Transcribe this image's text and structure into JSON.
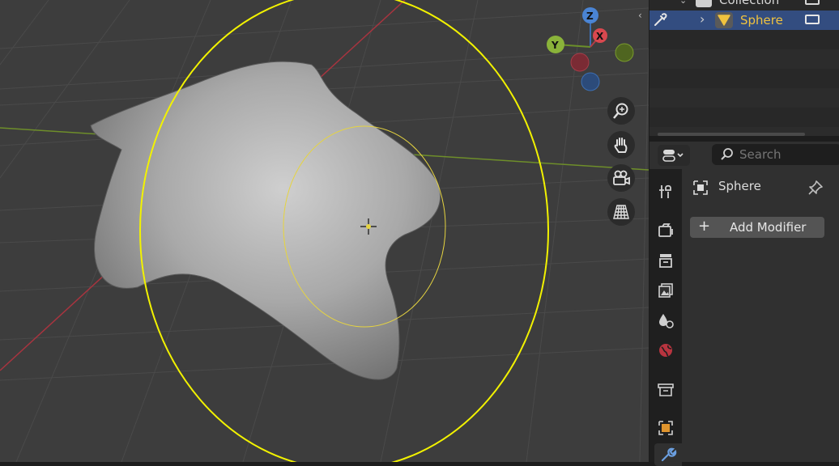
{
  "viewport": {
    "gizmo": {
      "z_label": "Z",
      "x_label": "X",
      "y_label": "Y"
    },
    "nav_buttons": [
      "zoom-icon",
      "pan-hand-icon",
      "camera-icon",
      "ortho-grid-icon"
    ],
    "colors": {
      "background": "#3d3d3d",
      "selection": "#f2f200",
      "x_axis": "#a8343f",
      "y_axis": "#7da02b"
    }
  },
  "outliner": {
    "collection_label": "Collection",
    "object_label": "Sphere",
    "colors": {
      "selected_row": "#334d80",
      "active_text": "#f0c23e"
    }
  },
  "properties": {
    "search": {
      "placeholder": "Search"
    },
    "object_name": "Sphere",
    "add_modifier_label": "Add Modifier",
    "tabs": [
      "tool-icon",
      "render-icon",
      "output-icon",
      "view-layer-icon",
      "scene-icon",
      "world-icon",
      "collection-icon",
      "object-icon",
      "modifier-wrench-icon"
    ]
  }
}
